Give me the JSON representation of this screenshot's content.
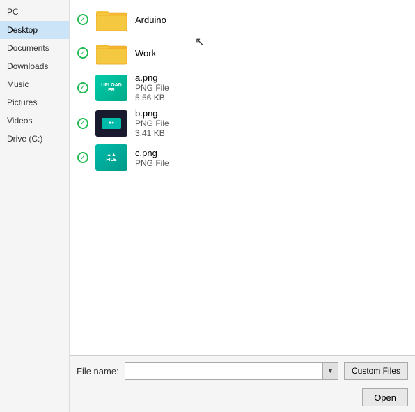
{
  "sidebar": {
    "items": [
      {
        "label": "PC",
        "active": false
      },
      {
        "label": "Desktop",
        "active": true
      },
      {
        "label": "Documents",
        "active": false
      },
      {
        "label": "Downloads",
        "active": false
      },
      {
        "label": "Music",
        "active": false
      },
      {
        "label": "Pictures",
        "active": false
      },
      {
        "label": "Videos",
        "active": false
      },
      {
        "label": "Drive (C:)",
        "active": false
      }
    ]
  },
  "files": [
    {
      "name": "Arduino",
      "type": "folder",
      "size": "",
      "checked": true
    },
    {
      "name": "Work",
      "type": "folder",
      "size": "",
      "checked": true
    },
    {
      "name": "a.png",
      "type": "PNG File",
      "size": "5.56 KB",
      "checked": true,
      "thumb": "a"
    },
    {
      "name": "b.png",
      "type": "PNG File",
      "size": "3.41 KB",
      "checked": true,
      "thumb": "b"
    },
    {
      "name": "c.png",
      "type": "PNG File",
      "size": "",
      "checked": true,
      "thumb": "c"
    }
  ],
  "bottom": {
    "filename_label": "File name:",
    "filename_value": "",
    "file_type_label": "Custom Files",
    "open_label": "Open"
  }
}
